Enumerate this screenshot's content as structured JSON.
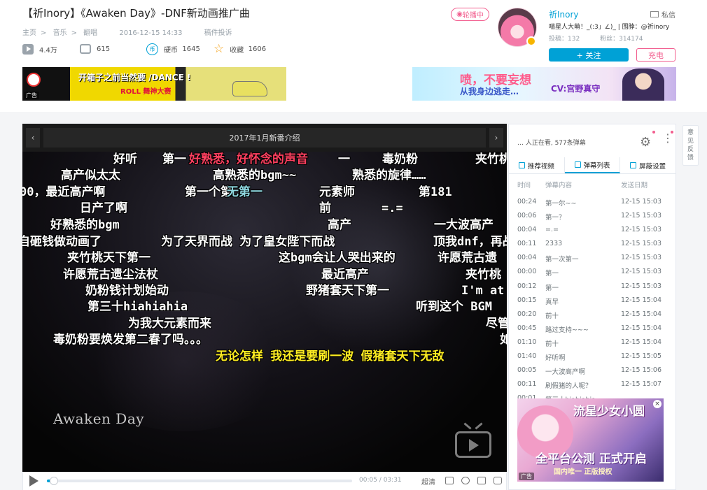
{
  "video": {
    "title": "【祈Inory】《Awaken Day》-DNF新动画推广曲",
    "breadcrumb": [
      "主页",
      "音乐",
      "翻唱"
    ],
    "sep": ">",
    "date": "2016-12-15 14:33",
    "report": "稿件投诉",
    "stats": {
      "plays": "4.4万",
      "danmaku": "615",
      "coins_label": "硬币",
      "coins": "1645",
      "fav_label": "收藏",
      "fav": "1606"
    }
  },
  "ads": {
    "left_text": "开箱子之前当然要 /DANCE !",
    "left_sub": "ROLL 舞神大赛",
    "right_text": "喷，不要妄想",
    "right_text2": "从我身边逃走…",
    "right_cv": "CV:宫野真守",
    "badge": "广告",
    "side_title": "流星少女小圆",
    "side_main": "全平台公测 正式开启",
    "side_sub": "国内唯一 正版授权"
  },
  "uploader": {
    "live": "轮播中",
    "name": "祈Inory",
    "message": "私信",
    "sign": "喵星人大萌！_(:3」∠)_ | 围脖：@祈inory",
    "videos_label": "投稿：",
    "videos": "132",
    "fans_label": "粉丝：",
    "fans": "314174",
    "follow": "+ 关注",
    "charge": "充电"
  },
  "player": {
    "playlist_title": "2017年1月新番介绍",
    "prev": "‹",
    "next": "›",
    "watermark": "Awaken Day",
    "time_current": "00:05",
    "time_total": "03:31",
    "quality": "超清",
    "progress_fraction": 0.024,
    "danmaku": [
      {
        "text": "好听",
        "color": "#ffffff"
      },
      {
        "text": "第一",
        "color": "#ffffff"
      },
      {
        "text": "好熟悉，好怀念的声音",
        "color": "#ff4060"
      },
      {
        "text": "一",
        "color": "#ffffff"
      },
      {
        "text": "毒奶粉",
        "color": "#ffffff"
      },
      {
        "text": "夹竹桃",
        "color": "#ffffff"
      },
      {
        "text": "高产似太太",
        "color": "#ffffff"
      },
      {
        "text": "高熟悉的bgm~~",
        "color": "#ffffff"
      },
      {
        "text": "熟悉的旋律……",
        "color": "#ffffff"
      },
      {
        "text": "00，最近高产啊",
        "color": "#ffffff"
      },
      {
        "text": "第一个第",
        "color": "#ffffff"
      },
      {
        "text": "无第一",
        "color": "#8fd8e0"
      },
      {
        "text": "元素师",
        "color": "#ffffff"
      },
      {
        "text": "第181",
        "color": "#ffffff"
      },
      {
        "text": "日产了啊",
        "color": "#ffffff"
      },
      {
        "text": "前",
        "color": "#ffffff"
      },
      {
        "text": "=.=",
        "color": "#ffffff"
      },
      {
        "text": "好熟悉的bgm",
        "color": "#ffffff"
      },
      {
        "text": "高产",
        "color": "#ffffff"
      },
      {
        "text": "一大波高产",
        "color": "#ffffff"
      },
      {
        "text": "自砸钱做动画了",
        "color": "#ffffff"
      },
      {
        "text": "为了天界而战 为了皇女陛下而战",
        "color": "#ffffff"
      },
      {
        "text": "顶我dnf，再战",
        "color": "#ffffff"
      },
      {
        "text": "夹竹桃天下第一",
        "color": "#ffffff"
      },
      {
        "text": "这bgm会让人哭出来的",
        "color": "#ffffff"
      },
      {
        "text": "许愿荒古遗",
        "color": "#ffffff"
      },
      {
        "text": "许愿荒古遗尘法杖",
        "color": "#ffffff"
      },
      {
        "text": "最近高产",
        "color": "#ffffff"
      },
      {
        "text": "夹竹桃",
        "color": "#ffffff"
      },
      {
        "text": "奶粉钱计划始动",
        "color": "#ffffff"
      },
      {
        "text": "野猪套天下第一",
        "color": "#ffffff"
      },
      {
        "text": "I'm at",
        "color": "#ffffff"
      },
      {
        "text": "第三十hiahiahia",
        "color": "#ffffff"
      },
      {
        "text": "听到这个 BGM",
        "color": "#ffffff"
      },
      {
        "text": "为我大元素而来",
        "color": "#ffffff"
      },
      {
        "text": "尽管",
        "color": "#ffffff"
      },
      {
        "text": "毒奶粉要焕发第二春了吗。。。",
        "color": "#ffffff"
      },
      {
        "text": "如",
        "color": "#ffffff"
      },
      {
        "text": "无论怎样 我还是要刷一波 假猪套天下无敌",
        "color": "#ffee22"
      }
    ]
  },
  "sidebar": {
    "watching": "… 人正在看, 577条弹幕",
    "tabs": [
      "推荐视频",
      "弹幕列表",
      "屏蔽设置"
    ],
    "columns": [
      "时间",
      "弹幕内容",
      "发送日期"
    ],
    "rows": [
      {
        "time": "00:24",
        "content": "第一尔~~",
        "date": "12-15 15:03"
      },
      {
        "time": "00:06",
        "content": "第一？",
        "date": "12-15 15:03"
      },
      {
        "time": "00:04",
        "content": "=.=",
        "date": "12-15 15:03"
      },
      {
        "time": "00:11",
        "content": "2333",
        "date": "12-15 15:03"
      },
      {
        "time": "00:04",
        "content": "第一次第一",
        "date": "12-15 15:03"
      },
      {
        "time": "00:00",
        "content": "第一",
        "date": "12-15 15:03"
      },
      {
        "time": "00:12",
        "content": "第一",
        "date": "12-15 15:03"
      },
      {
        "time": "00:15",
        "content": "真早",
        "date": "12-15 15:04"
      },
      {
        "time": "00:20",
        "content": "前十",
        "date": "12-15 15:04"
      },
      {
        "time": "00:45",
        "content": "路过支持~~~",
        "date": "12-15 15:04"
      },
      {
        "time": "01:10",
        "content": "前十",
        "date": "12-15 15:04"
      },
      {
        "time": "01:40",
        "content": "好听啊",
        "date": "12-15 15:05"
      },
      {
        "time": "00:05",
        "content": "一大波高产啊",
        "date": "12-15 15:06"
      },
      {
        "time": "00:11",
        "content": "刷假猪的人呢？",
        "date": "12-15 15:07"
      },
      {
        "time": "00:01",
        "content": "第三十hiahiahia",
        "date": ""
      }
    ],
    "close": "×"
  },
  "feedback": "意见反馈"
}
